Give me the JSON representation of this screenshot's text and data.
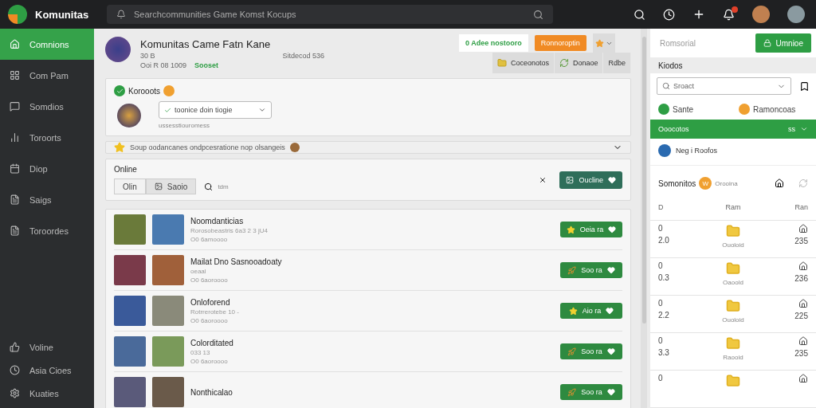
{
  "app": {
    "name": "Komunitas"
  },
  "search": {
    "placeholder": "Searchcommunities Game Komst Kocups"
  },
  "sidebar": {
    "items": [
      {
        "label": "Comnions",
        "selected": true
      },
      {
        "label": "Com Pam",
        "selected": false
      },
      {
        "label": "Somdios",
        "selected": false
      },
      {
        "label": "Toroorts",
        "selected": false
      },
      {
        "label": "Diop",
        "selected": false
      },
      {
        "label": "Saigs",
        "selected": false
      },
      {
        "label": "Toroordes",
        "selected": false
      }
    ],
    "footer": [
      {
        "label": "Voline"
      },
      {
        "label": "Asia Cioes"
      },
      {
        "label": "Kuaties"
      }
    ]
  },
  "header": {
    "title": "Komunitas Came Fatn Kane",
    "meta": "30 B",
    "meta_right": "Sitdecod 536",
    "stats": "Ooi R 08 1009",
    "status": "Sooset",
    "join": "0 Adee nostooro",
    "cta": "Ronnoroptin",
    "tabs": [
      {
        "label": "Coceonotos",
        "selected": false
      },
      {
        "label": "Donaoe",
        "selected": false
      },
      {
        "label": "Rdbe",
        "selected": false
      }
    ]
  },
  "post": {
    "title": "Korooots",
    "select": "toonice doin tiogie",
    "caption": "ussesstiouromess"
  },
  "banner": {
    "text": "Soup oodancanes ondpcesratione nop olsangeis"
  },
  "online": {
    "title": "Online",
    "segments": [
      {
        "label": "Olin",
        "selected": true
      },
      {
        "label": "Saoio",
        "selected": false
      }
    ],
    "search": "tdm",
    "button": "Oucline"
  },
  "games": [
    {
      "title": "Noomdanticias",
      "subtitle": "Rorosobeastris 6a3 2 3 jU4",
      "meta": "O0 6amoooo",
      "kind": "star",
      "action": "Oeia ra"
    },
    {
      "title": "Mailat Dno Sasnooadoaty",
      "subtitle": "oeaal",
      "meta": "O0 6aoroooo",
      "kind": "rocket",
      "action": "Soo ra"
    },
    {
      "title": "Onloforend",
      "subtitle": "Rotrrerotebe 10 -",
      "meta": "O0 6aoroooo",
      "kind": "star",
      "action": "Aio ra"
    },
    {
      "title": "Colorditated",
      "subtitle": "033 13",
      "meta": "O0 6aoroooo",
      "kind": "rocket",
      "action": "Soo ra"
    },
    {
      "title": "Nonthicalao",
      "kind": "rocket",
      "action": "Soo ra"
    }
  ],
  "panel": {
    "title": "Romsorial",
    "button": "Umnioe",
    "section": "Kiodos",
    "select": "Sroact",
    "options": [
      {
        "label": "Sante",
        "color": "#2e9e44"
      },
      {
        "label": "Ramoncoas",
        "color": "#f0a030"
      }
    ],
    "items": [
      {
        "label": "Ooocotos",
        "extra": "ss",
        "selected": true
      },
      {
        "label": "Neg i Roofos",
        "selected": false
      }
    ],
    "group": {
      "title": "Somonitos",
      "badge": "W",
      "sub": "Orooina"
    },
    "columns": [
      "D",
      "Ram",
      "Ran"
    ],
    "rows": [
      {
        "a": "0",
        "b": "2.0",
        "name": "Ouoloid",
        "score": "235"
      },
      {
        "a": "0",
        "b": "0.3",
        "name": "Oaoold",
        "score": "236"
      },
      {
        "a": "0",
        "b": "2.2",
        "name": "Ouoloid",
        "score": "225"
      },
      {
        "a": "0",
        "b": "3.3",
        "name": "Raooid",
        "score": "235"
      },
      {
        "a": "0"
      }
    ]
  }
}
